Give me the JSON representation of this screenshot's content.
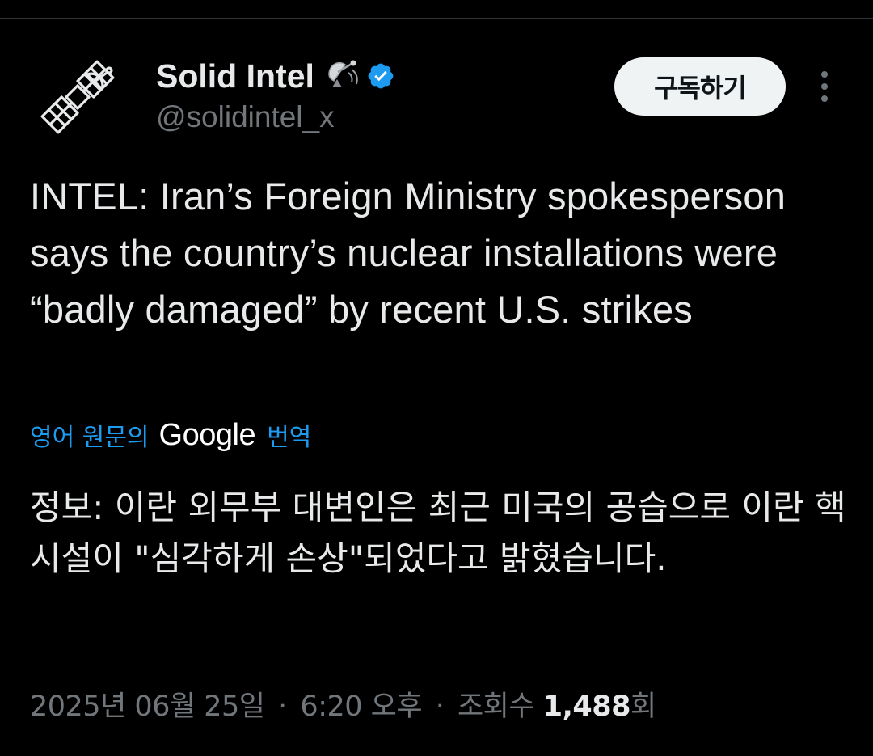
{
  "author": {
    "display_name": "Solid Intel",
    "handle": "@solidintel_x",
    "verified": true,
    "avatar_icon": "satellite-icon",
    "name_emoji_icon": "satellite-antenna-icon"
  },
  "actions": {
    "subscribe_label": "구독하기",
    "more_icon": "more-vertical-icon"
  },
  "tweet": {
    "text": "INTEL: Iran’s Foreign Ministry spokesperson says the country’s nuclear installations were “badly damaged” by recent U.S. strikes"
  },
  "translation": {
    "prefix": "영어 원문의",
    "provider": "Google",
    "suffix": "번역",
    "text": "정보: 이란 외무부 대변인은 최근 미국의 공습으로 이란 핵 시설이 \"심각하게 손상\"되었다고 밝혔습니다."
  },
  "meta": {
    "date": "2025년 06월 25일",
    "separator": "·",
    "time": "6:20 오후",
    "views_label": "조회수",
    "views_count": "1,488",
    "views_suffix": "회"
  },
  "colors": {
    "background": "#000000",
    "text": "#e7e9ea",
    "secondary": "#71767b",
    "link": "#1d9bf0",
    "verified": "#1d9bf0",
    "button_bg": "#eff3f4"
  }
}
